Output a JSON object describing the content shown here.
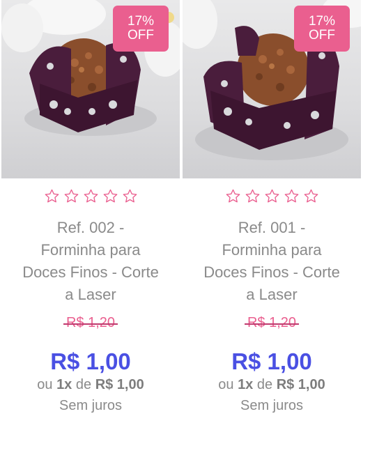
{
  "products": [
    {
      "badge": {
        "line1": "17%",
        "line2": "OFF"
      },
      "rating": {
        "stars": 0,
        "max": 5
      },
      "title_lines": [
        "Ref. 002 -",
        "Forminha para",
        "Doces Finos - Corte",
        "a Laser"
      ],
      "old_price": "R$ 1,20",
      "price": "R$ 1,00",
      "installments": {
        "prefix": "ou",
        "count": "1x",
        "middle": "de",
        "amount": "R$ 1,00"
      },
      "terms": "Sem juros"
    },
    {
      "badge": {
        "line1": "17%",
        "line2": "OFF"
      },
      "rating": {
        "stars": 0,
        "max": 5
      },
      "title_lines": [
        "Ref. 001 -",
        "Forminha para",
        "Doces Finos - Corte",
        "a Laser"
      ],
      "old_price": "R$ 1,20",
      "price": "R$ 1,00",
      "installments": {
        "prefix": "ou",
        "count": "1x",
        "middle": "de",
        "amount": "R$ 1,00"
      },
      "terms": "Sem juros"
    }
  ],
  "colors": {
    "badge": "#ea5f8f",
    "price": "#4a50e3",
    "old_price": "#ea5f8f",
    "star_outline": "#ea5f8f",
    "text_muted": "#8a8a8a",
    "wrapper_purple": "#4a1d3c",
    "sweet_brown": "#8a4e2c"
  }
}
